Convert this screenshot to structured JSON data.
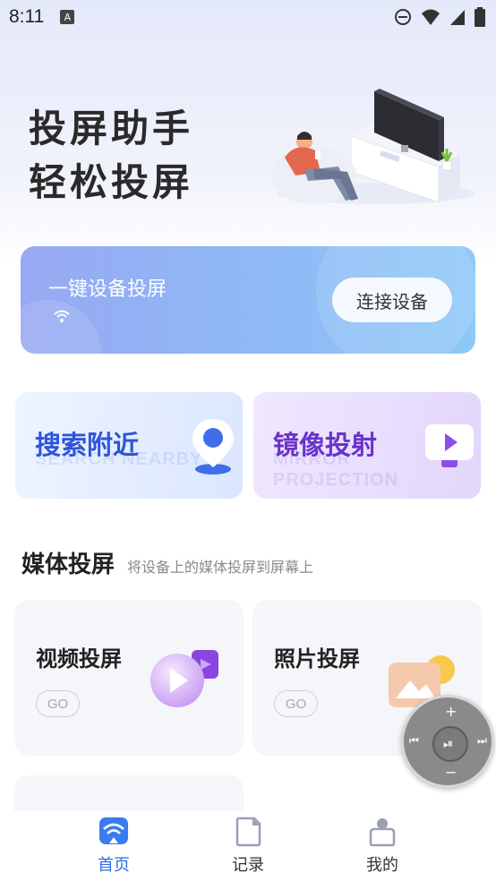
{
  "status_bar": {
    "time": "8:11"
  },
  "hero": {
    "line1": "投屏助手",
    "line2": "轻松投屏"
  },
  "banner": {
    "title": "一键设备投屏",
    "button": "连接设备"
  },
  "features": {
    "search": {
      "title": "搜索附近",
      "subtitle": "SEARCH NEARBY"
    },
    "mirror": {
      "title": "镜像投射",
      "subtitle": "MIRROR PROJECTION"
    }
  },
  "media_section": {
    "title": "媒体投屏",
    "description": "将设备上的媒体投屏到屏幕上",
    "cards": [
      {
        "label": "视频投屏",
        "go": "GO"
      },
      {
        "label": "照片投屏",
        "go": "GO"
      }
    ]
  },
  "remote": {
    "plus": "+",
    "minus": "−",
    "prev": "⏮",
    "play_pause": "⏯",
    "next": "⏭"
  },
  "tabbar": {
    "items": [
      {
        "label": "首页",
        "icon": "cast-home-icon",
        "active": true
      },
      {
        "label": "记录",
        "icon": "document-icon",
        "active": false
      },
      {
        "label": "我的",
        "icon": "user-icon",
        "active": false
      }
    ]
  },
  "colors": {
    "primary": "#2f6ee8",
    "search_accent": "#2e55d8",
    "mirror_accent": "#6a33c9"
  }
}
